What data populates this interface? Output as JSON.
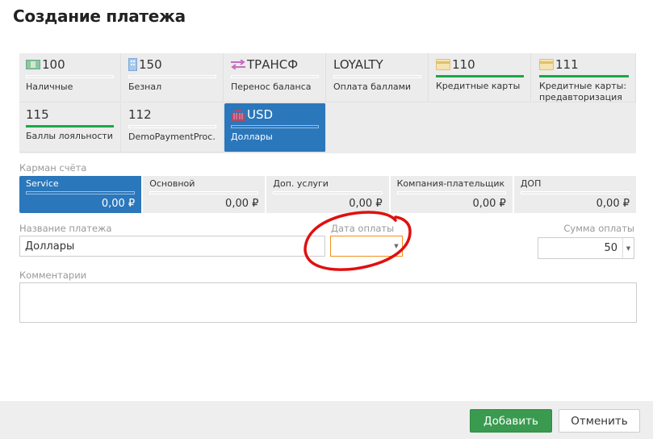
{
  "title": "Создание платежа",
  "payment_types": [
    {
      "code": "100",
      "name": "Наличные",
      "icon": "cash-icon",
      "highlight": false
    },
    {
      "code": "150",
      "name": "Безнал",
      "icon": "building-icon",
      "highlight": false
    },
    {
      "code": "ТРАНСФ",
      "name": "Перенос баланса",
      "icon": "transfer-icon",
      "highlight": false
    },
    {
      "code": "LOYALTY",
      "name": "Оплата баллами",
      "icon": "",
      "highlight": false
    },
    {
      "code": "110",
      "name": "Кредитные карты",
      "icon": "credit-card-icon",
      "highlight": true
    },
    {
      "code": "111",
      "name": "Кредитные карты: предавторизация",
      "icon": "credit-card-icon",
      "highlight": true
    },
    {
      "code": "115",
      "name": "Баллы лояльности",
      "icon": "",
      "highlight": true
    },
    {
      "code": "112",
      "name": "DemoPaymentProc...",
      "icon": "",
      "highlight": false
    },
    {
      "code": "USD",
      "name": "Доллары",
      "icon": "bank-icon",
      "highlight": false,
      "active": true
    }
  ],
  "pocket_label": "Карман счёта",
  "pockets": [
    {
      "name": "Service",
      "value": "0,00 ₽",
      "active": true
    },
    {
      "name": "Основной",
      "value": "0,00 ₽"
    },
    {
      "name": "Доп. услуги",
      "value": "0,00 ₽"
    },
    {
      "name": "Компания-плательщик",
      "value": "0,00 ₽"
    },
    {
      "name": "ДОП",
      "value": "0,00 ₽"
    }
  ],
  "form": {
    "name_label": "Название платежа",
    "name_value": "Доллары",
    "date_label": "Дата оплаты",
    "date_value": "",
    "sum_label": "Сумма оплаты",
    "sum_value": "50",
    "comment_label": "Комментарии",
    "comment_value": ""
  },
  "buttons": {
    "add": "Добавить",
    "cancel": "Отменить"
  },
  "colors": {
    "accent": "#2b77bb",
    "green": "#1aa84a",
    "add_button": "#3a9a4f",
    "annotation": "#e01010"
  }
}
